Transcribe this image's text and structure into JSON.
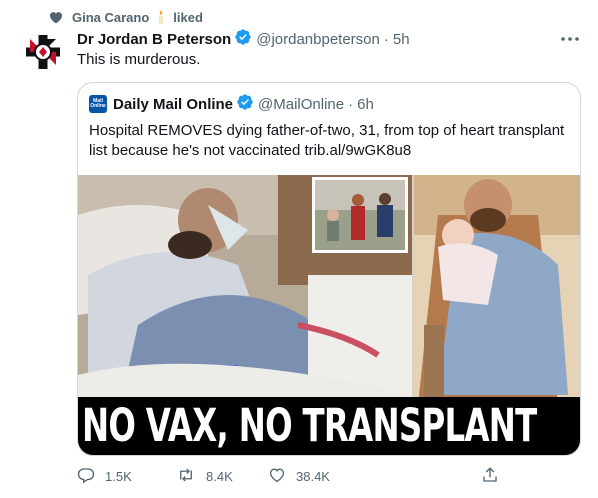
{
  "social_context": {
    "user": "Gina Carano",
    "action": "liked"
  },
  "tweet": {
    "author_name": "Dr Jordan B Peterson",
    "handle": "@jordanbpeterson",
    "separator": "·",
    "time": "5h",
    "text": "This is murderous."
  },
  "quote": {
    "author_name": "Daily Mail Online",
    "handle": "@MailOnline",
    "separator": "·",
    "time": "6h",
    "text": "Hospital REMOVES dying father-of-two, 31, from top of heart transplant list because he's not vaccinated trib.al/9wGK8u8",
    "logo_text_top": "Mail",
    "logo_text_bottom": "Online",
    "image_headline": "NO VAX, NO TRANSPLANT"
  },
  "actions": {
    "reply_count": "1.5K",
    "retweet_count": "8.4K",
    "like_count": "38.4K"
  },
  "colors": {
    "verified": "#1d9bf0",
    "muted": "#536471",
    "border": "#cfd9de"
  }
}
